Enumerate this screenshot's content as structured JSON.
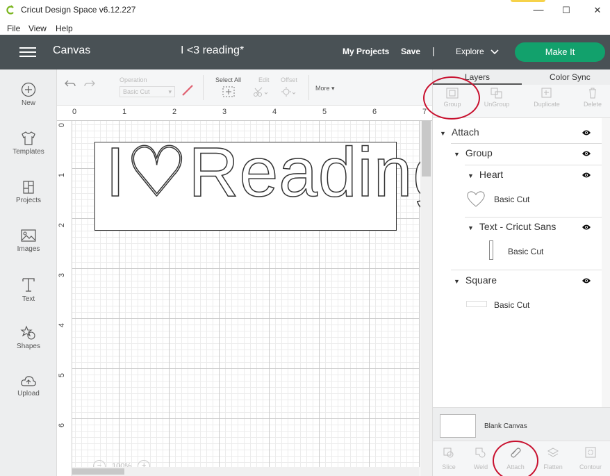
{
  "window": {
    "title": "Cricut Design Space  v6.12.227",
    "minimize": "—",
    "maximize": "☐",
    "close": "✕"
  },
  "menu": [
    "File",
    "View",
    "Help"
  ],
  "nav": {
    "canvas": "Canvas",
    "project_name": "I <3 reading*",
    "my_projects": "My Projects",
    "save": "Save",
    "separator": "|",
    "explore": "Explore",
    "make_it": "Make It",
    "make_it_color": "#12a16c"
  },
  "sidebar": [
    {
      "label": "New",
      "icon": "plus-circle-icon"
    },
    {
      "label": "Templates",
      "icon": "tshirt-icon"
    },
    {
      "label": "Projects",
      "icon": "projects-icon"
    },
    {
      "label": "Images",
      "icon": "image-icon"
    },
    {
      "label": "Text",
      "icon": "text-icon"
    },
    {
      "label": "Shapes",
      "icon": "shapes-icon"
    },
    {
      "label": "Upload",
      "icon": "upload-icon"
    }
  ],
  "toolbar": {
    "operation_label": "Operation",
    "operation_value": "Basic Cut",
    "select_all": "Select All",
    "edit": "Edit",
    "offset": "Offset",
    "more": "More"
  },
  "ruler": {
    "top": [
      "0",
      "1",
      "2",
      "3",
      "4",
      "5",
      "6",
      "7"
    ],
    "left": [
      "0",
      "1",
      "2",
      "3",
      "4",
      "5",
      "6"
    ]
  },
  "canvas": {
    "design_text": "I♡Reading",
    "zoom": "100%"
  },
  "panel": {
    "tabs": [
      "Layers",
      "Color Sync"
    ],
    "layer_actions": [
      "Group",
      "UnGroup",
      "Duplicate",
      "Delete"
    ],
    "layers": {
      "attach": "Attach",
      "group": "Group",
      "heart": "Heart",
      "heart_op": "Basic Cut",
      "text": "Text - Cricut Sans",
      "text_op": "Basic Cut",
      "square": "Square",
      "square_op": "Basic Cut"
    },
    "blank_canvas": "Blank Canvas",
    "bottom_actions": [
      "Slice",
      "Weld",
      "Attach",
      "Flatten",
      "Contour"
    ]
  },
  "highlight_color": "#c8102e"
}
